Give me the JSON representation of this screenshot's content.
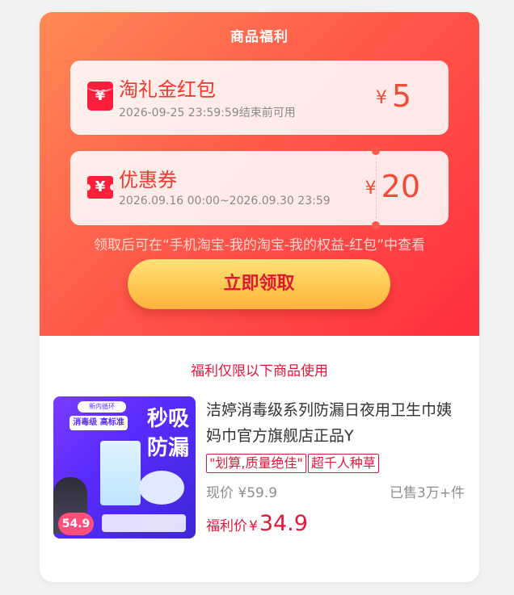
{
  "header": {
    "title": "商品福利"
  },
  "coupons": [
    {
      "name": "淘礼金红包",
      "desc": "2026-09-25 23:59:59结束前可用",
      "currency": "¥",
      "amount": "5",
      "icon": "red-envelope-icon"
    },
    {
      "name": "优惠券",
      "desc": "2026.09.16 00:00~2026.09.30 23:59",
      "currency": "¥",
      "amount": "20",
      "icon": "ticket-icon"
    }
  ],
  "hint": "领取后可在“手机淘宝-我的淘宝-我的权益-红包”中查看",
  "claim_button": "立即领取",
  "section_title": "福利仅限以下商品使用",
  "product": {
    "title": "洁婷消毒级系列防漏日夜用卫生巾姨妈巾官方旗舰店正品Y",
    "chips": [
      "\"划算,质量绝佳\"",
      "超千人种草"
    ],
    "now_price_label": "现价",
    "now_price_currency": "¥",
    "now_price": "59.9",
    "sold": "已售3万+件",
    "benefit_label": "福利价",
    "benefit_currency": "¥",
    "benefit_price": "34.9",
    "image": {
      "brand": "新内循环",
      "tag": "消毒级 高标准",
      "headline": "秒吸防漏",
      "price_badge": "54.9"
    }
  },
  "colors": {
    "accent": "#e4173b",
    "gradient_start": "#ff8a55",
    "gradient_end": "#ff2f3f",
    "button": "#ffc64e"
  }
}
